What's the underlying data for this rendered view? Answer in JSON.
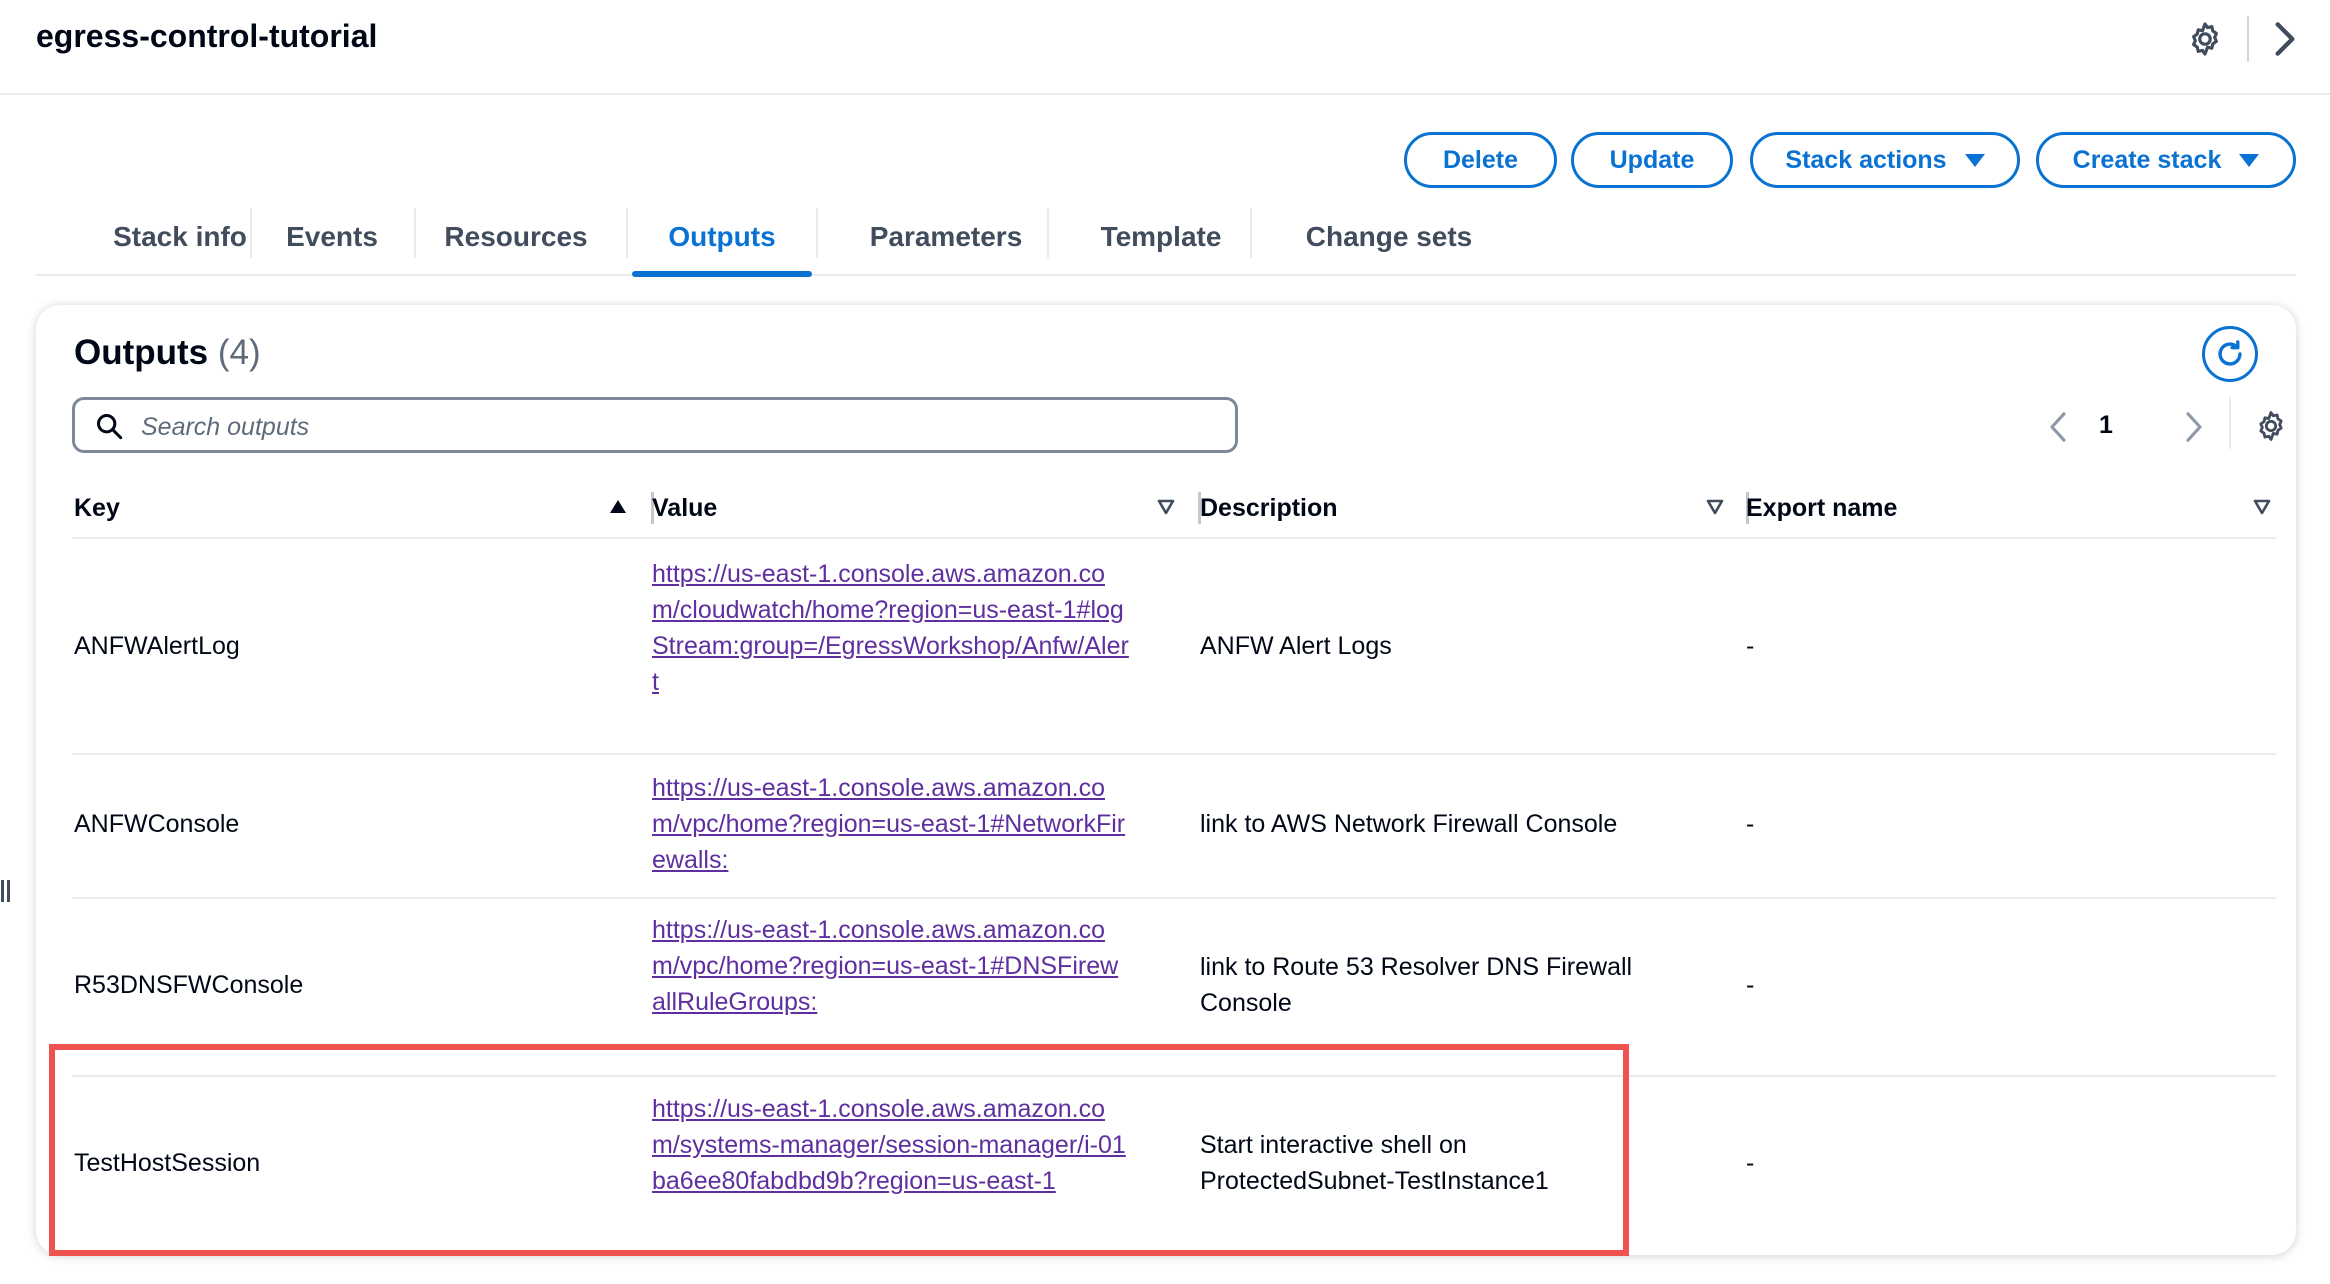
{
  "header": {
    "stack_name": "egress-control-tutorial",
    "icons": [
      "gear-icon",
      "chevron-right-icon"
    ]
  },
  "actions": {
    "delete": "Delete",
    "update": "Update",
    "stack_actions": "Stack actions",
    "create_stack": "Create stack"
  },
  "tabs": [
    {
      "label": "Stack info"
    },
    {
      "label": "Events"
    },
    {
      "label": "Resources"
    },
    {
      "label": "Outputs",
      "active": true
    },
    {
      "label": "Parameters"
    },
    {
      "label": "Template"
    },
    {
      "label": "Change sets"
    }
  ],
  "outputs": {
    "title": "Outputs",
    "count": "(4)",
    "search_placeholder": "Search outputs",
    "page": "1",
    "columns": {
      "key": "Key",
      "value": "Value",
      "description": "Description",
      "export_name": "Export name"
    },
    "rows": [
      {
        "key": "ANFWAlertLog",
        "value": "https://us-east-1.console.aws.amazon.com/cloudwatch/home?region=us-east-1#logStream:group=/EgressWorkshop/Anfw/Alert",
        "description": "ANFW Alert Logs",
        "export_name": "-"
      },
      {
        "key": "ANFWConsole",
        "value": "https://us-east-1.console.aws.amazon.com/vpc/home?region=us-east-1#NetworkFirewalls:",
        "description": "link to AWS Network Firewall Console",
        "export_name": "-"
      },
      {
        "key": "R53DNSFWConsole",
        "value": "https://us-east-1.console.aws.amazon.com/vpc/home?region=us-east-1#DNSFirewallRuleGroups:",
        "description": "link to Route 53 Resolver DNS Firewall Console",
        "export_name": "-"
      },
      {
        "key": "TestHostSession",
        "value": "https://us-east-1.console.aws.amazon.com/systems-manager/session-manager/i-01ba6ee80fabdbd9b?region=us-east-1",
        "description": "Start interactive shell on ProtectedSubnet-TestInstance1",
        "export_name": "-"
      }
    ]
  },
  "colors": {
    "accent": "#0972d3",
    "link_visited": "#5f2fa0",
    "highlight_border": "#ef5350"
  }
}
